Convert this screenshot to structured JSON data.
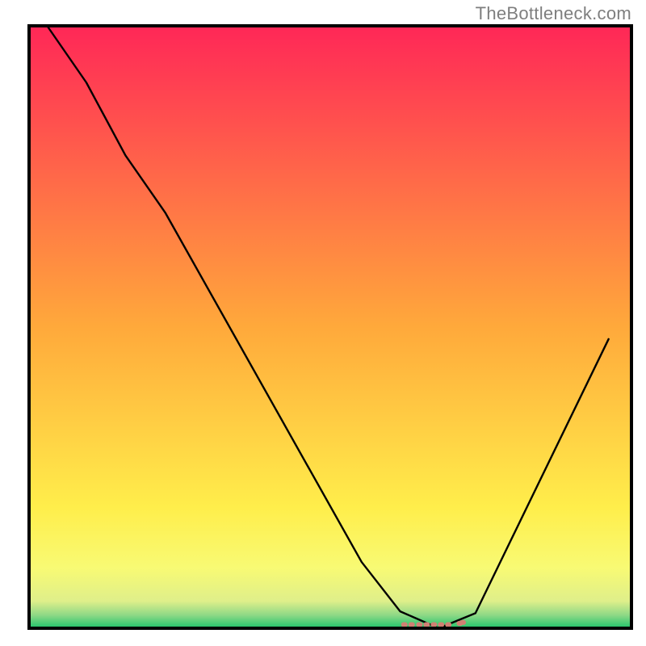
{
  "watermark": {
    "text": "TheBottleneck.com"
  },
  "chart_data": {
    "type": "line",
    "title": "",
    "xlabel": "",
    "ylabel": "",
    "xlim": [
      0,
      100
    ],
    "ylim": [
      0,
      100
    ],
    "grid": false,
    "legend": null,
    "background": {
      "type": "vertical_gradient",
      "stops": [
        {
          "offset": 0.0,
          "color": "#ff2757"
        },
        {
          "offset": 0.5,
          "color": "#ffa93b"
        },
        {
          "offset": 0.8,
          "color": "#ffee4b"
        },
        {
          "offset": 0.9,
          "color": "#f8fa74"
        },
        {
          "offset": 0.955,
          "color": "#dfef8a"
        },
        {
          "offset": 0.978,
          "color": "#8fd986"
        },
        {
          "offset": 1.0,
          "color": "#1ec36b"
        }
      ]
    },
    "series": [
      {
        "name": "bottleneck-curve",
        "type": "line",
        "color": "#000000",
        "x": [
          3.0,
          9.5,
          16.0,
          22.6,
          55.2,
          61.6,
          68.0,
          74.1,
          96.2
        ],
        "y": [
          100.0,
          90.6,
          78.5,
          69.0,
          11.0,
          2.8,
          0.0,
          2.5,
          48.0
        ]
      },
      {
        "name": "optimal-range-marker",
        "type": "line",
        "color": "#d08073",
        "x": [
          62.3,
          63.5,
          64.8,
          66.0,
          67.2,
          68.4,
          69.6,
          71.5,
          72.0
        ],
        "y": [
          0.6,
          0.6,
          0.6,
          0.6,
          0.6,
          0.6,
          0.6,
          0.8,
          0.95
        ]
      }
    ]
  }
}
